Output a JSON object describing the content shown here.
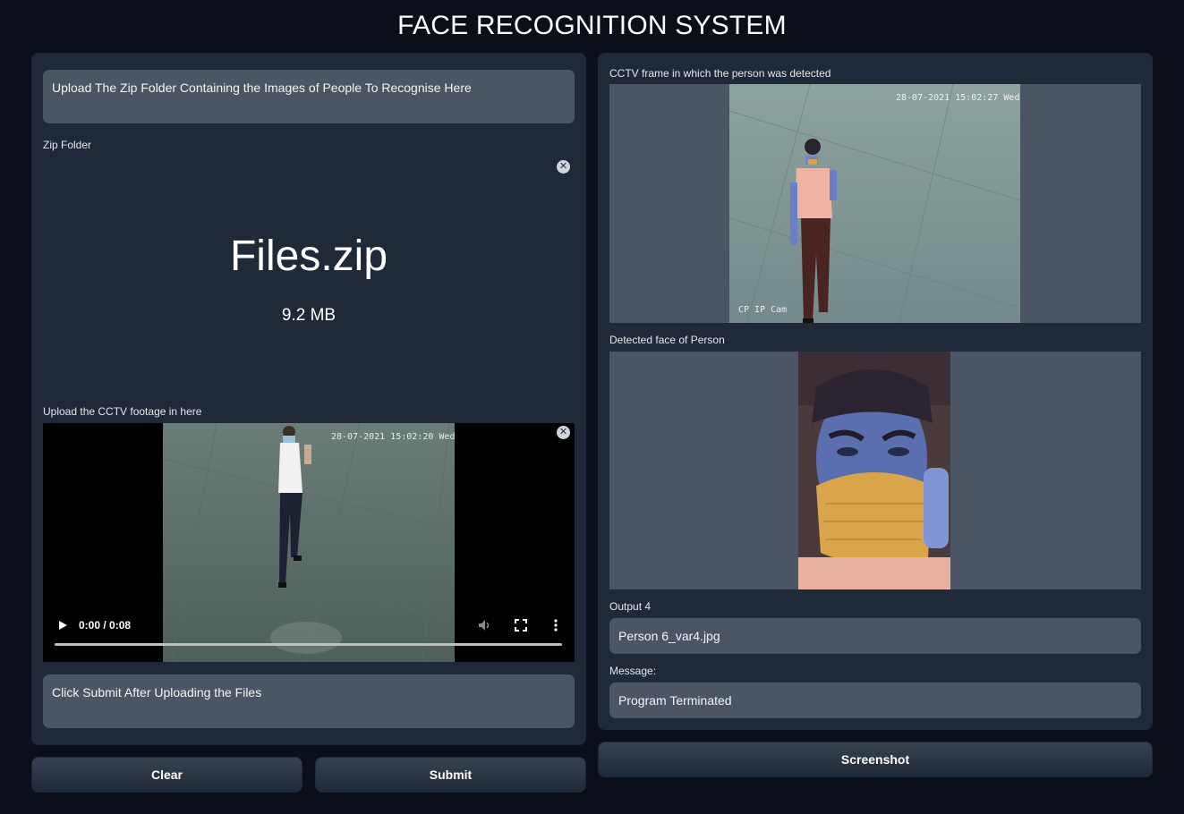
{
  "app": {
    "title": "FACE RECOGNITION SYSTEM"
  },
  "left": {
    "instruction_text": "Upload The Zip Folder Containing the Images of People To Recognise Here",
    "zip_label": "Zip Folder",
    "file_name": "Files.zip",
    "file_size": "9.2 MB",
    "video_label": "Upload the CCTV footage in here",
    "video_time": "0:00 / 0:08",
    "video_progress": 0,
    "video_overlay_timestamp": "28-07-2021 15:02:20 Wed",
    "submit_hint": "Click Submit After Uploading the Files",
    "clear_label": "Clear",
    "submit_label": "Submit"
  },
  "right": {
    "frame_label": "CCTV frame in which the person was detected",
    "frame_overlay_timestamp": "28-07-2021 15:02:27 Wed",
    "frame_overlay_cam": "CP IP Cam",
    "face_label": "Detected face of Person",
    "output4_label": "Output 4",
    "output4_value": "Person 6_var4.jpg",
    "message_label": "Message:",
    "message_value": "Program Terminated",
    "screenshot_label": "Screenshot"
  },
  "icons": {
    "close": "close-icon",
    "play": "play-icon",
    "volume": "volume-icon",
    "fullscreen": "fullscreen-icon",
    "more": "more-vert-icon"
  },
  "colors": {
    "background": "#0b0f19",
    "panel": "#1f2937",
    "field": "#4b5563",
    "text": "#ffffff"
  }
}
